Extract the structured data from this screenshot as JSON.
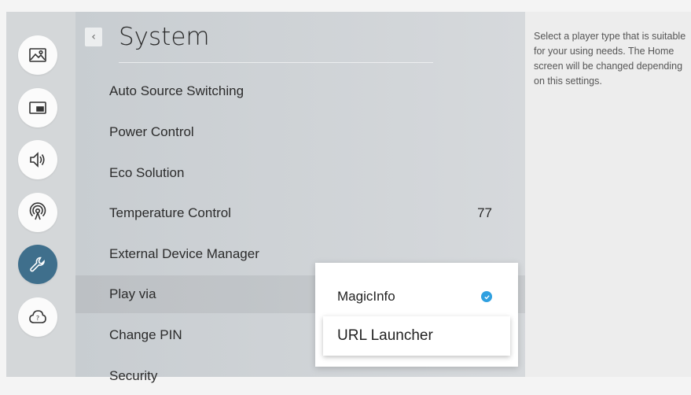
{
  "header": {
    "title": "System",
    "back_icon": "chevron-left-icon"
  },
  "rail": {
    "icons": [
      "picture-icon",
      "pip-icon",
      "sound-icon",
      "network-icon",
      "wrench-icon",
      "support-icon"
    ],
    "active": "wrench-icon",
    "active_color": "#3f6f8c"
  },
  "menu": {
    "items": [
      {
        "label": "Auto Source Switching",
        "value": ""
      },
      {
        "label": "Power Control",
        "value": ""
      },
      {
        "label": "Eco Solution",
        "value": ""
      },
      {
        "label": "Temperature Control",
        "value": "77"
      },
      {
        "label": "External Device Manager",
        "value": ""
      },
      {
        "label": "Play via",
        "value": ""
      },
      {
        "label": "Change PIN",
        "value": ""
      },
      {
        "label": "Security",
        "value": ""
      }
    ]
  },
  "popup": {
    "options": [
      {
        "label": "MagicInfo",
        "selected": true
      },
      {
        "label": "URL Launcher",
        "selected": false
      }
    ],
    "check_color": "#2fa0e0"
  },
  "description": "Select a player type that is suitable for your using needs. The Home screen will be changed depending on this settings."
}
